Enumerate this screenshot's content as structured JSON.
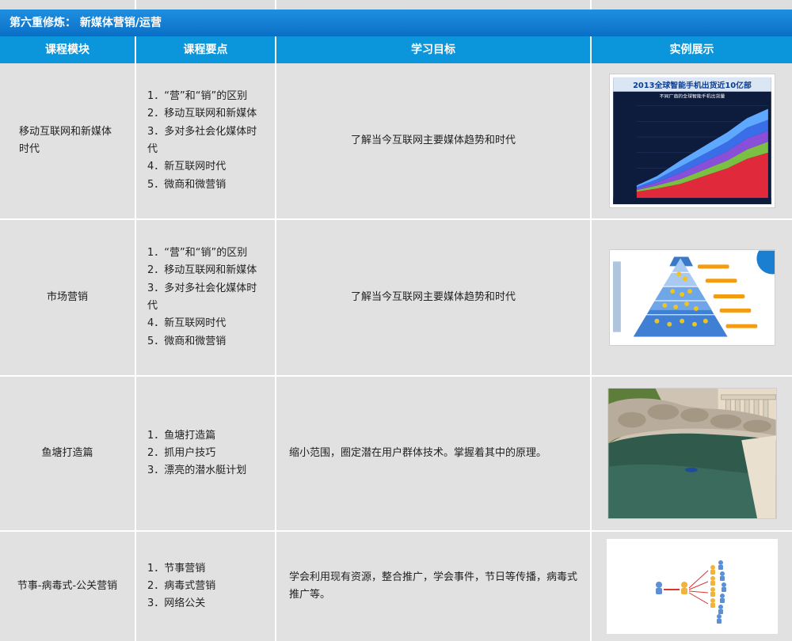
{
  "section": {
    "title": "第六重修炼： 新媒体营销/运营"
  },
  "headers": {
    "module": "课程模块",
    "points": "课程要点",
    "goal": "学习目标",
    "example": "实例展示"
  },
  "rows": [
    {
      "module": "移动互联网和新媒体时代",
      "points": [
        "1．“营”和“销”的区别",
        "2．移动互联网和新媒体",
        "3．多对多社会化媒体时代",
        "4．新互联网时代",
        "5．微商和微营销"
      ],
      "goal": "了解当今互联网主要媒体趋势和时代",
      "example": {
        "title": "2013全球智能手机出货近10亿部",
        "subtitle": "不同厂商的全球智能手机出货量"
      }
    },
    {
      "module": "市场营销",
      "points": [
        "1．“营”和“销”的区别",
        "2．移动互联网和新媒体",
        "3．多对多社会化媒体时代",
        "4．新互联网时代",
        "5．微商和微营销"
      ],
      "goal": "了解当今互联网主要媒体趋势和时代",
      "example": {}
    },
    {
      "module": "鱼塘打造篇",
      "points": [
        "1．鱼塘打造篇",
        "2．抓用户技巧",
        "3．漂亮的潜水艇计划"
      ],
      "goal": "缩小范围，圈定潜在用户群体技术。掌握着其中的原理。",
      "example": {}
    },
    {
      "module": "节事-病毒式-公关营销",
      "points": [
        "1．节事营销",
        "2．病毒式营销",
        "3．网络公关"
      ],
      "goal": "学会利用现有资源，整合推广，学会事件，节日等传播，病毒式推广等。",
      "example": {}
    }
  ]
}
